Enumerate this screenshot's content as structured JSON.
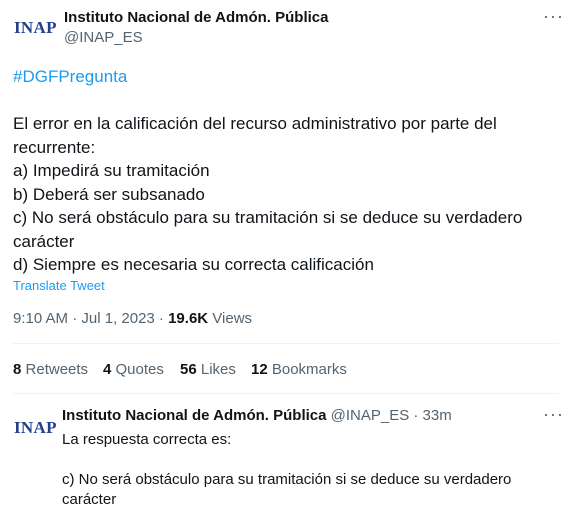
{
  "tweet": {
    "author_logo": "INAP",
    "author_name": "Instituto Nacional de Admón. Pública",
    "handle": "@INAP_ES",
    "more_icon": "more-horizontal-icon",
    "hashtag": "#DGFPregunta",
    "lines": [
      "El error en la calificación del recurso administrativo por parte del",
      "recurrente:",
      "a) Impedirá su tramitación",
      "b) Deberá ser subsanado",
      "c) No será obstáculo para su tramitación si se deduce su verdadero",
      "carácter",
      "d) Siempre es necesaria su correcta calificación"
    ],
    "translate": "Translate Tweet",
    "timestamp": "9:10 AM · Jul 1, 2023 · ",
    "views_count": "19.6K",
    "views_label": " Views"
  },
  "stats": {
    "retweets_count": "8",
    "retweets_label": "Retweets",
    "quotes_count": "4",
    "quotes_label": "Quotes",
    "likes_count": "56",
    "likes_label": "Likes",
    "bookmarks_count": "12",
    "bookmarks_label": "Bookmarks"
  },
  "reply": {
    "author_logo": "INAP",
    "author_name": "Instituto Nacional de Admón. Pública",
    "handle_time": "@INAP_ES · 33m",
    "line1": "La respuesta correcta es:",
    "line2": "c) No será obstáculo para su tramitación si se deduce su verdadero",
    "line3": "carácter"
  },
  "colors": {
    "link": "#1d9bf0",
    "muted": "#536471",
    "logo": "#1f3f8f"
  }
}
